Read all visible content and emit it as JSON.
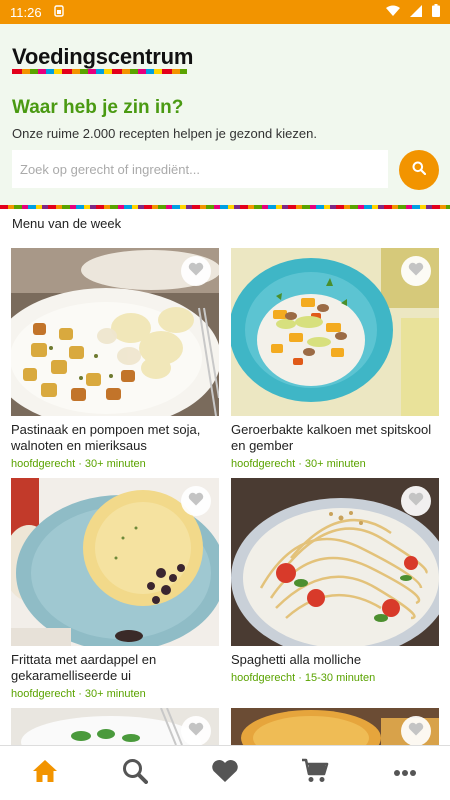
{
  "status_bar": {
    "time": "11:26"
  },
  "header": {
    "brand": "Voedingscentrum",
    "greeting": "Waar heb je zin in?",
    "subtitle": "Onze ruime 2.000 recepten helpen je gezond kiezen.",
    "search_placeholder": "Zoek op gerecht of ingrediënt..."
  },
  "section": {
    "title": "Menu van de week"
  },
  "recipes": [
    {
      "title": "Pastinaak en pompoen met soja, walnoten en mieriksaus",
      "category": "hoofdgerecht",
      "time": "30+ minuten"
    },
    {
      "title": "Geroerbakte kalkoen met spitskool en gember",
      "category": "hoofdgerecht",
      "time": "30+ minuten"
    },
    {
      "title": "Frittata met aardappel en gekaramelliseerde ui",
      "category": "hoofdgerecht",
      "time": "30+ minuten"
    },
    {
      "title": "Spaghetti alla molliche",
      "category": "hoofdgerecht",
      "time": "15-30 minuten"
    }
  ],
  "nav": {
    "active": "home",
    "items": [
      "home-icon",
      "search-icon",
      "heart-icon",
      "cart-icon",
      "more-icon"
    ]
  },
  "colors": {
    "accent": "#f29400",
    "green": "#4a9a12",
    "nav_inactive": "#555555"
  }
}
